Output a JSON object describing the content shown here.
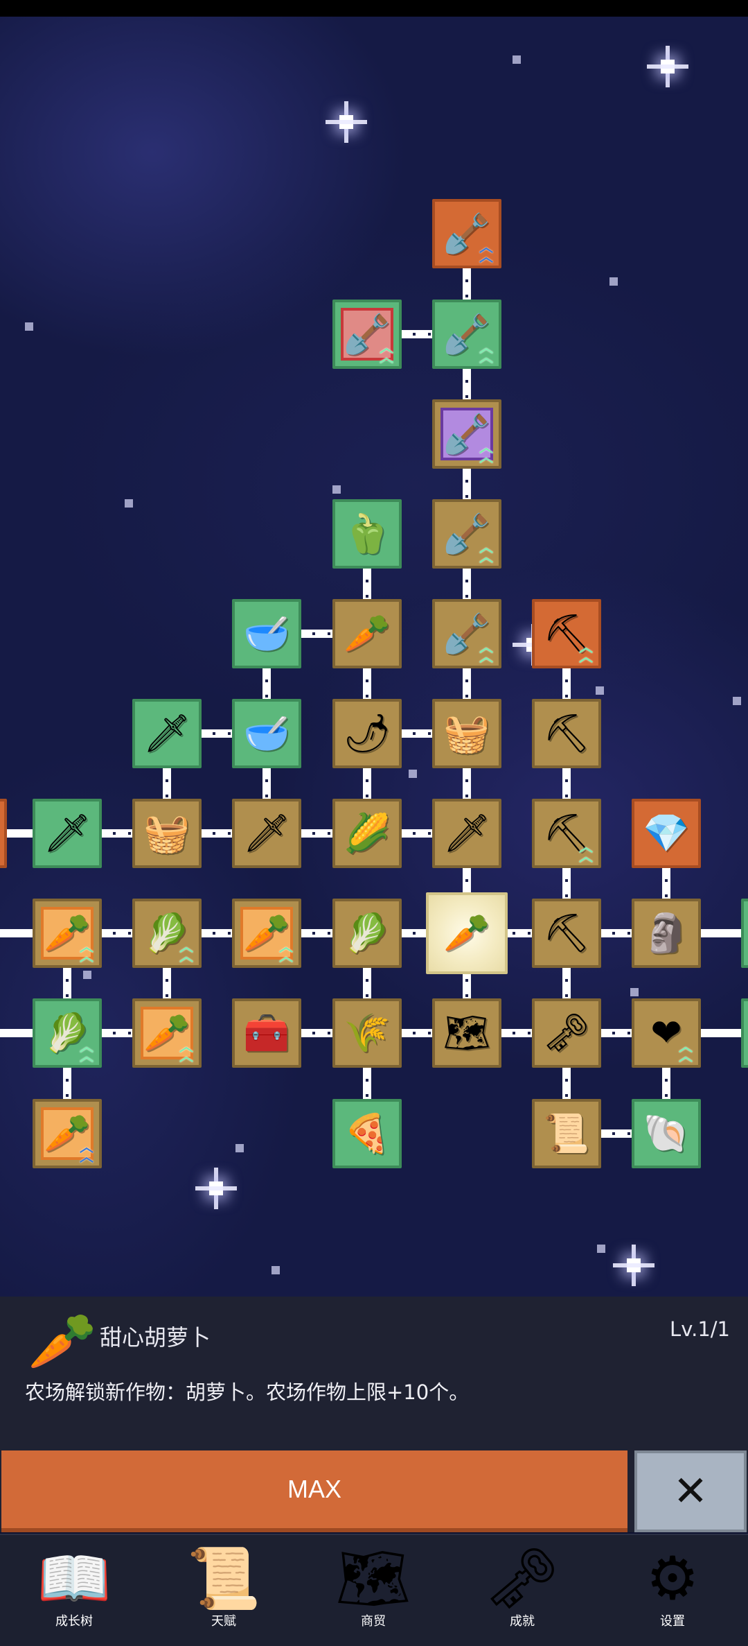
{
  "tree": {
    "nodes": [
      {
        "id": "n1",
        "color": "orange",
        "icon": "🪏",
        "frame": "",
        "upgrade": "blue-chevrons"
      },
      {
        "id": "n2",
        "color": "green",
        "icon": "🪏",
        "frame": "red",
        "upgrade": "green-chevrons"
      },
      {
        "id": "n3",
        "color": "green",
        "icon": "🪏",
        "frame": "",
        "upgrade": "green-chevrons"
      },
      {
        "id": "n4",
        "color": "tan",
        "icon": "🪏",
        "frame": "purple",
        "upgrade": "green-chevrons"
      },
      {
        "id": "n5",
        "color": "green",
        "icon": "🫑",
        "frame": "",
        "upgrade": ""
      },
      {
        "id": "n6",
        "color": "tan",
        "icon": "🪏",
        "frame": "",
        "upgrade": "green-chevrons"
      },
      {
        "id": "n7",
        "color": "green",
        "icon": "🥣",
        "frame": "",
        "upgrade": ""
      },
      {
        "id": "n8",
        "color": "tan",
        "icon": "🥕",
        "frame": "",
        "upgrade": ""
      },
      {
        "id": "n9",
        "color": "tan",
        "icon": "🪏",
        "frame": "",
        "upgrade": "green-chevrons"
      },
      {
        "id": "n10",
        "color": "orange",
        "icon": "⛏",
        "frame": "",
        "upgrade": "green-chevrons"
      },
      {
        "id": "n11",
        "color": "green",
        "icon": "🗡",
        "frame": "",
        "upgrade": ""
      },
      {
        "id": "n12",
        "color": "green",
        "icon": "🥣",
        "frame": "",
        "upgrade": ""
      },
      {
        "id": "n13",
        "color": "tan",
        "icon": "🌶",
        "frame": "",
        "upgrade": ""
      },
      {
        "id": "n14",
        "color": "tan",
        "icon": "🧺",
        "frame": "",
        "upgrade": ""
      },
      {
        "id": "n15",
        "color": "tan",
        "icon": "⛏",
        "frame": "",
        "upgrade": ""
      },
      {
        "id": "n16",
        "color": "green",
        "icon": "🗡",
        "frame": "",
        "upgrade": ""
      },
      {
        "id": "n17",
        "color": "tan",
        "icon": "🧺",
        "frame": "",
        "upgrade": ""
      },
      {
        "id": "n18",
        "color": "tan",
        "icon": "🗡",
        "frame": "",
        "upgrade": ""
      },
      {
        "id": "n19",
        "color": "tan",
        "icon": "🌽",
        "frame": "",
        "upgrade": ""
      },
      {
        "id": "n20",
        "color": "tan",
        "icon": "🗡",
        "frame": "",
        "upgrade": ""
      },
      {
        "id": "n21",
        "color": "tan",
        "icon": "⛏",
        "frame": "",
        "upgrade": "green-chevrons"
      },
      {
        "id": "n22",
        "color": "orange",
        "icon": "💎",
        "frame": "",
        "upgrade": ""
      },
      {
        "id": "n23",
        "color": "tan",
        "icon": "🥕",
        "frame": "orange",
        "upgrade": "green-chevrons"
      },
      {
        "id": "n24",
        "color": "tan",
        "icon": "🥬",
        "frame": "",
        "upgrade": "green-chevrons"
      },
      {
        "id": "n25",
        "color": "tan",
        "icon": "🥕",
        "frame": "orange",
        "upgrade": "green-chevrons"
      },
      {
        "id": "n26",
        "color": "tan",
        "icon": "🥬",
        "frame": "",
        "upgrade": ""
      },
      {
        "id": "n27",
        "color": "selected",
        "icon": "🥕",
        "frame": "",
        "upgrade": ""
      },
      {
        "id": "n28",
        "color": "tan",
        "icon": "⛏",
        "frame": "",
        "upgrade": ""
      },
      {
        "id": "n29",
        "color": "tan",
        "icon": "🗿",
        "frame": "",
        "upgrade": ""
      },
      {
        "id": "n30",
        "color": "green",
        "icon": "🥬",
        "frame": "",
        "upgrade": "green-chevrons"
      },
      {
        "id": "n31",
        "color": "tan",
        "icon": "🥕",
        "frame": "orange",
        "upgrade": "green-chevrons"
      },
      {
        "id": "n32",
        "color": "tan",
        "icon": "🧰",
        "frame": "",
        "upgrade": ""
      },
      {
        "id": "n33",
        "color": "tan",
        "icon": "🌾",
        "frame": "",
        "upgrade": ""
      },
      {
        "id": "n34",
        "color": "tan",
        "icon": "🗺",
        "frame": "",
        "upgrade": ""
      },
      {
        "id": "n35",
        "color": "tan",
        "icon": "🗝",
        "frame": "",
        "upgrade": ""
      },
      {
        "id": "n36",
        "color": "tan",
        "icon": "❤",
        "frame": "",
        "upgrade": "green-chevrons"
      },
      {
        "id": "n37",
        "color": "tan",
        "icon": "🥕",
        "frame": "orange",
        "upgrade": "blue-chevrons"
      },
      {
        "id": "n38",
        "color": "green",
        "icon": "🍕",
        "frame": "",
        "upgrade": ""
      },
      {
        "id": "n39",
        "color": "tan",
        "icon": "📜",
        "frame": "",
        "upgrade": ""
      },
      {
        "id": "n40",
        "color": "green",
        "icon": "🐚",
        "frame": "",
        "upgrade": ""
      }
    ]
  },
  "detail": {
    "icon": "🥕",
    "title": "甜心胡萝卜",
    "level": "Lv.1/1",
    "description": "农场解锁新作物：胡萝卜。农场作物上限+10个。",
    "max_label": "MAX",
    "close_icon": "close-icon",
    "close_glyph": "✕"
  },
  "nav": [
    {
      "label": "成长树",
      "icon": "📖",
      "name": "growth-tree-book-icon"
    },
    {
      "label": "天赋",
      "icon": "📜",
      "name": "talent-scroll-icon"
    },
    {
      "label": "商贸",
      "icon": "🗺",
      "name": "trade-map-icon"
    },
    {
      "label": "成就",
      "icon": "🗝",
      "name": "achievement-key-icon"
    },
    {
      "label": "设置",
      "icon": "⚙",
      "name": "settings-gear-icon"
    }
  ],
  "colors": {
    "green": "#5cb87c",
    "orange": "#d46a34",
    "tan": "#b08f4e",
    "max_button": "#d26a38",
    "close_button": "#a9b4c2",
    "panel": "#1f2232"
  }
}
